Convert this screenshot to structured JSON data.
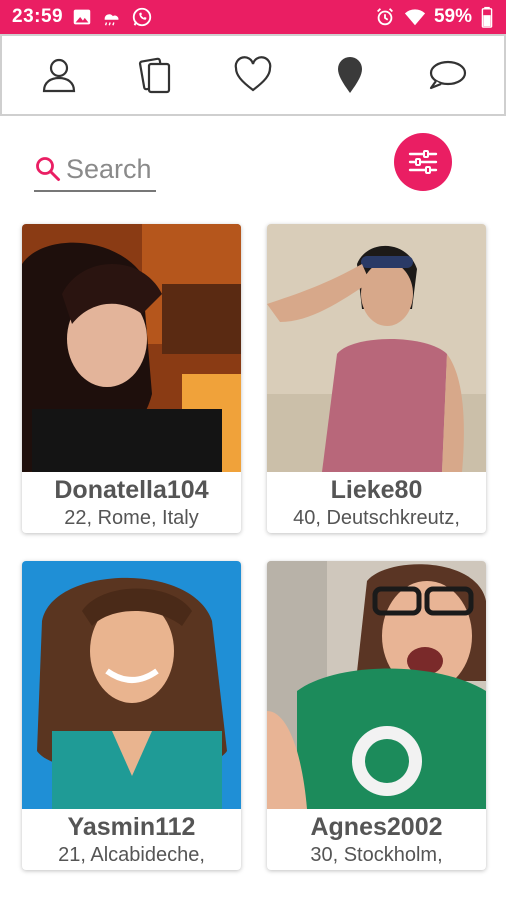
{
  "status_bar": {
    "time": "23:59",
    "battery": "59%",
    "background_color": "#ea1e63",
    "left_icons": [
      "image-icon",
      "weather-icon",
      "whatsapp-icon"
    ],
    "right_icons": [
      "alarm-icon",
      "wifi-icon",
      "battery-icon"
    ]
  },
  "nav": {
    "items": [
      {
        "icon": "profile-icon"
      },
      {
        "icon": "cards-icon"
      },
      {
        "icon": "heart-icon"
      },
      {
        "icon": "location-pin-icon"
      },
      {
        "icon": "chat-bubble-icon"
      }
    ]
  },
  "search": {
    "placeholder": "Search",
    "value": ""
  },
  "filter": {
    "icon": "sliders-icon",
    "color": "#ea1e63"
  },
  "profiles": [
    {
      "username": "Donatella104",
      "details": "22, Rome, Italy"
    },
    {
      "username": "Lieke80",
      "details": "40, Deutschkreutz,"
    },
    {
      "username": "Yasmin112",
      "details": "21, Alcabideche,"
    },
    {
      "username": "Agnes2002",
      "details": "30, Stockholm,"
    }
  ]
}
